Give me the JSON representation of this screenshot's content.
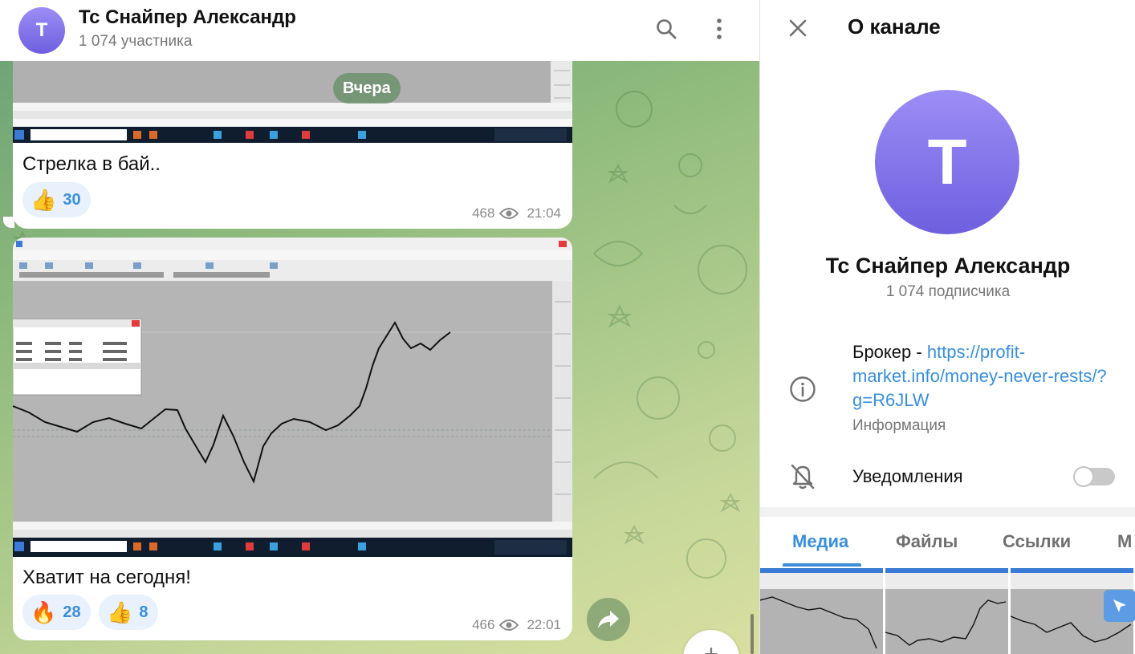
{
  "chat": {
    "title": "Тс Снайпер Александр",
    "subtitle": "1 074 участника",
    "avatar_letter": "T",
    "date_pill": "Вчера",
    "icons": [
      "search-icon",
      "more-vertical-icon",
      "share-icon",
      "plus-icon",
      "eye-icon"
    ],
    "messages": [
      {
        "text": "Стрелка в бай..",
        "reactions": [
          {
            "emoji": "👍",
            "count": "30"
          }
        ],
        "views": "468",
        "time": "21:04"
      },
      {
        "text": "Хватит на сегодня!",
        "reactions": [
          {
            "emoji": "🔥",
            "count": "28"
          },
          {
            "emoji": "👍",
            "count": "8"
          }
        ],
        "views": "466",
        "time": "22:01"
      }
    ]
  },
  "panel": {
    "title": "О канале",
    "avatar_letter": "T",
    "name": "Тс Снайпер Александр",
    "subscribers": "1 074 подписчика",
    "info_prefix": "Брокер - ",
    "info_link": "https://profit-market.info/money-never-rests/?g=R6JLW",
    "info_label": "Информация",
    "notifications_label": "Уведомления",
    "notifications_on": false,
    "tabs": [
      "Медиа",
      "Файлы",
      "Ссылки",
      "М"
    ],
    "active_tab": 0,
    "icons": [
      "close-icon",
      "info-icon",
      "bell-off-icon",
      "cursor-icon"
    ]
  },
  "colors": {
    "accent": "#3a8fd8",
    "avatar_top": "#9c8df6",
    "avatar_bottom": "#6e5fdf"
  }
}
